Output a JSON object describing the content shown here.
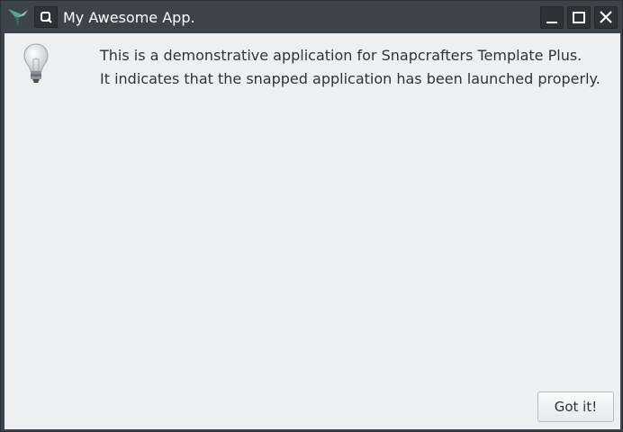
{
  "window": {
    "title": "My Awesome App."
  },
  "titlebar_icons": [
    "app-logo-icon",
    "sticky-icon",
    "minimize-icon",
    "maximize-icon",
    "close-icon"
  ],
  "dialog": {
    "icon": "lightbulb-icon",
    "message_lines": [
      "This is a demonstrative application for Snapcrafters Template Plus.",
      "It indicates that the snapped application has been launched properly."
    ],
    "button_label": "Got it!"
  },
  "colors": {
    "titlebar": "#3c434b",
    "content_bg": "#eeeff1",
    "text": "#2f3337",
    "logo_green": "#5aa09a"
  }
}
